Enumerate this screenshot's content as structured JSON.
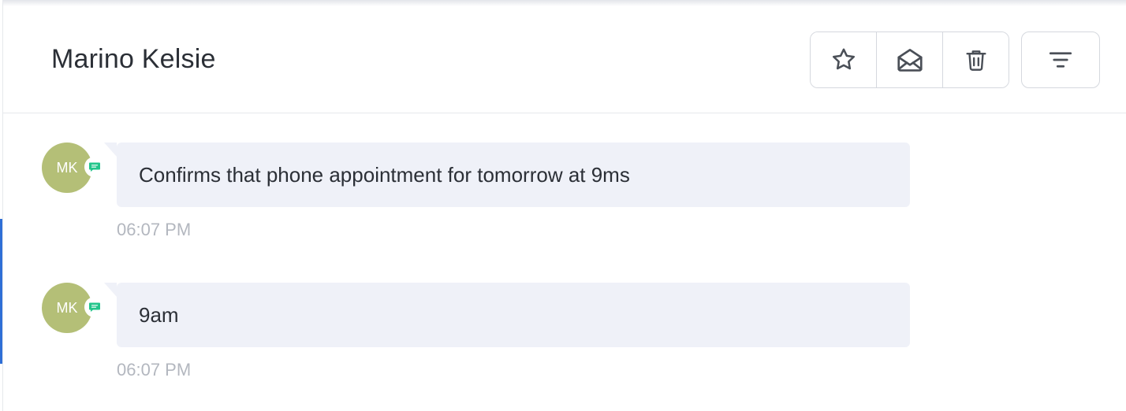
{
  "header": {
    "contact_name": "Marino Kelsie"
  },
  "toolbar": {
    "buttons": [
      {
        "icon": "star-icon"
      },
      {
        "icon": "envelope-open-icon"
      },
      {
        "icon": "trash-icon"
      }
    ],
    "filter_icon": "filter-icon"
  },
  "messages": [
    {
      "avatar_initials": "MK",
      "channel_icon": "sms-icon",
      "text": "Confirms that phone appointment for tomorrow at 9ms",
      "time": "06:07 PM"
    },
    {
      "avatar_initials": "MK",
      "channel_icon": "sms-icon",
      "text": "9am",
      "time": "06:07 PM"
    }
  ],
  "colors": {
    "avatar": "#b4bf77",
    "bubble": "#eff1f8",
    "channel_badge": "#22c58b",
    "accent": "#2f6fd6"
  }
}
